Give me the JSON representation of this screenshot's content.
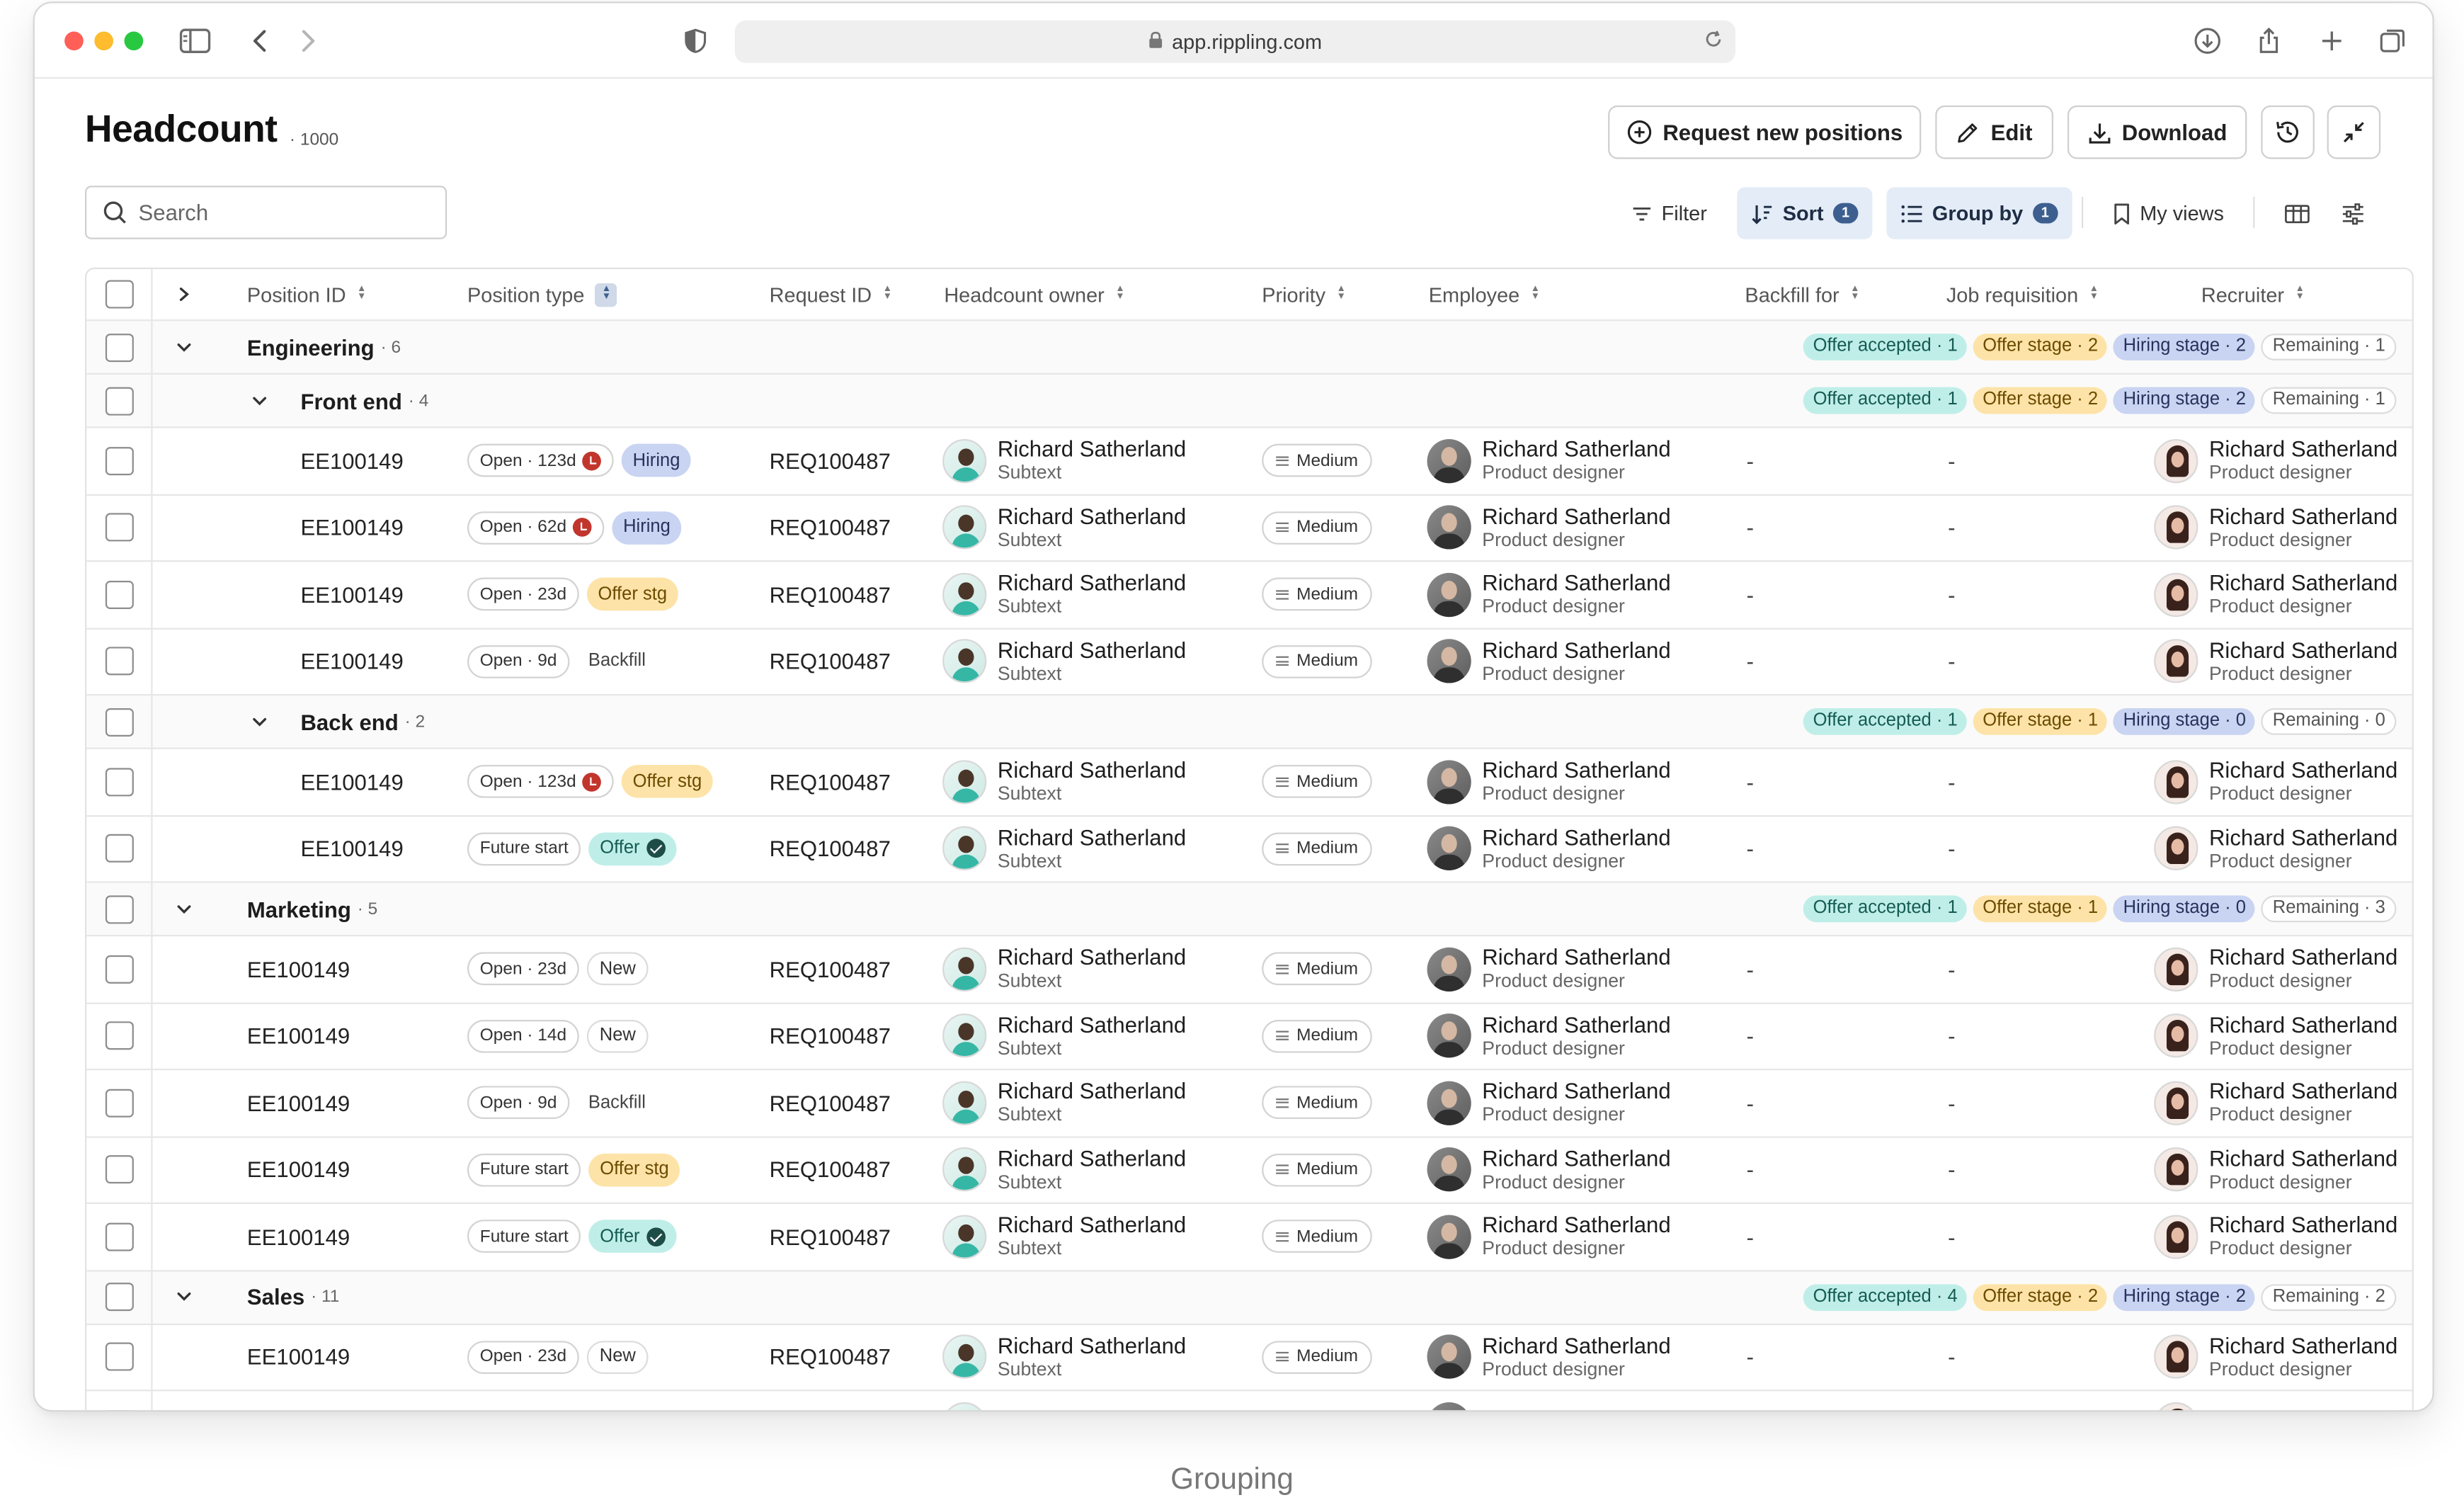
{
  "browser": {
    "url": "app.rippling.com"
  },
  "page": {
    "title": "Headcount",
    "count": "1000"
  },
  "actions": {
    "request": "Request new positions",
    "edit": "Edit",
    "download": "Download"
  },
  "toolbar": {
    "search_placeholder": "Search",
    "filter": "Filter",
    "sort": "Sort",
    "sort_count": "1",
    "group_by": "Group by",
    "group_count": "1",
    "my_views": "My views"
  },
  "columns": {
    "position_id": "Position ID",
    "position_type": "Position type",
    "request_id": "Request ID",
    "headcount_owner": "Headcount owner",
    "priority": "Priority",
    "employee": "Employee",
    "backfill_for": "Backfill for",
    "job_requisition": "Job requisition",
    "recruiter": "Recruiter"
  },
  "rows": [
    {
      "kind": "group",
      "level": 1,
      "name": "Engineering",
      "count": "· 6",
      "stats": [
        "Offer accepted · 1",
        "Offer stage · 2",
        "Hiring stage · 2",
        "Remaining · 1"
      ]
    },
    {
      "kind": "group",
      "level": 2,
      "name": "Front end",
      "count": "· 4",
      "stats": [
        "Offer accepted · 1",
        "Offer stage · 2",
        "Hiring stage · 2",
        "Remaining · 1"
      ]
    },
    {
      "kind": "data",
      "indent": 2,
      "pid": "EE100149",
      "open": "Open · 123d",
      "clock": true,
      "tag": "Hiring",
      "tag_style": "hiring",
      "req": "REQ100487",
      "owner": "Richard Satherland",
      "owner_sub": "Subtext",
      "priority": "Medium",
      "employee": "Richard Satherland",
      "employee_sub": "Product designer",
      "backfill": "-",
      "job": "-",
      "recruiter": "Richard Satherland",
      "recruiter_sub": "Product designer"
    },
    {
      "kind": "data",
      "indent": 2,
      "pid": "EE100149",
      "open": "Open · 62d",
      "clock": true,
      "tag": "Hiring",
      "tag_style": "hiring",
      "req": "REQ100487",
      "owner": "Richard Satherland",
      "owner_sub": "Subtext",
      "priority": "Medium",
      "employee": "Richard Satherland",
      "employee_sub": "Product designer",
      "backfill": "-",
      "job": "-",
      "recruiter": "Richard Satherland",
      "recruiter_sub": "Product designer"
    },
    {
      "kind": "data",
      "indent": 2,
      "pid": "EE100149",
      "open": "Open · 23d",
      "clock": false,
      "tag": "Offer stg",
      "tag_style": "offerstg",
      "req": "REQ100487",
      "owner": "Richard Satherland",
      "owner_sub": "Subtext",
      "priority": "Medium",
      "employee": "Richard Satherland",
      "employee_sub": "Product designer",
      "backfill": "-",
      "job": "-",
      "recruiter": "Richard Satherland",
      "recruiter_sub": "Product designer"
    },
    {
      "kind": "data",
      "indent": 2,
      "pid": "EE100149",
      "open": "Open · 9d",
      "clock": false,
      "tag": "Backfill",
      "tag_style": "backfill",
      "req": "REQ100487",
      "owner": "Richard Satherland",
      "owner_sub": "Subtext",
      "priority": "Medium",
      "employee": "Richard Satherland",
      "employee_sub": "Product designer",
      "backfill": "-",
      "job": "-",
      "recruiter": "Richard Satherland",
      "recruiter_sub": "Product designer"
    },
    {
      "kind": "group",
      "level": 2,
      "name": "Back end",
      "count": "· 2",
      "stats": [
        "Offer accepted · 1",
        "Offer stage · 1",
        "Hiring stage · 0",
        "Remaining · 0"
      ]
    },
    {
      "kind": "data",
      "indent": 2,
      "pid": "EE100149",
      "open": "Open · 123d",
      "clock": true,
      "tag": "Offer stg",
      "tag_style": "offerstg",
      "req": "REQ100487",
      "owner": "Richard Satherland",
      "owner_sub": "Subtext",
      "priority": "Medium",
      "employee": "Richard Satherland",
      "employee_sub": "Product designer",
      "backfill": "-",
      "job": "-",
      "recruiter": "Richard Satherland",
      "recruiter_sub": "Product designer"
    },
    {
      "kind": "data",
      "indent": 2,
      "pid": "EE100149",
      "open": "Future start",
      "clock": false,
      "tag": "Offer",
      "tag_style": "offer",
      "req": "REQ100487",
      "owner": "Richard Satherland",
      "owner_sub": "Subtext",
      "priority": "Medium",
      "employee": "Richard Satherland",
      "employee_sub": "Product designer",
      "backfill": "-",
      "job": "-",
      "recruiter": "Richard Satherland",
      "recruiter_sub": "Product designer"
    },
    {
      "kind": "group",
      "level": 1,
      "name": "Marketing",
      "count": "· 5",
      "stats": [
        "Offer accepted · 1",
        "Offer stage · 1",
        "Hiring stage · 0",
        "Remaining · 3"
      ]
    },
    {
      "kind": "data",
      "indent": 1,
      "pid": "EE100149",
      "open": "Open · 23d",
      "clock": false,
      "tag": "New",
      "tag_style": "new",
      "req": "REQ100487",
      "owner": "Richard Satherland",
      "owner_sub": "Subtext",
      "priority": "Medium",
      "employee": "Richard Satherland",
      "employee_sub": "Product designer",
      "backfill": "-",
      "job": "-",
      "recruiter": "Richard Satherland",
      "recruiter_sub": "Product designer"
    },
    {
      "kind": "data",
      "indent": 1,
      "pid": "EE100149",
      "open": "Open · 14d",
      "clock": false,
      "tag": "New",
      "tag_style": "new",
      "req": "REQ100487",
      "owner": "Richard Satherland",
      "owner_sub": "Subtext",
      "priority": "Medium",
      "employee": "Richard Satherland",
      "employee_sub": "Product designer",
      "backfill": "-",
      "job": "-",
      "recruiter": "Richard Satherland",
      "recruiter_sub": "Product designer"
    },
    {
      "kind": "data",
      "indent": 1,
      "pid": "EE100149",
      "open": "Open · 9d",
      "clock": false,
      "tag": "Backfill",
      "tag_style": "backfill",
      "req": "REQ100487",
      "owner": "Richard Satherland",
      "owner_sub": "Subtext",
      "priority": "Medium",
      "employee": "Richard Satherland",
      "employee_sub": "Product designer",
      "backfill": "-",
      "job": "-",
      "recruiter": "Richard Satherland",
      "recruiter_sub": "Product designer"
    },
    {
      "kind": "data",
      "indent": 1,
      "pid": "EE100149",
      "open": "Future start",
      "clock": false,
      "tag": "Offer stg",
      "tag_style": "offerstg",
      "req": "REQ100487",
      "owner": "Richard Satherland",
      "owner_sub": "Subtext",
      "priority": "Medium",
      "employee": "Richard Satherland",
      "employee_sub": "Product designer",
      "backfill": "-",
      "job": "-",
      "recruiter": "Richard Satherland",
      "recruiter_sub": "Product designer"
    },
    {
      "kind": "data",
      "indent": 1,
      "pid": "EE100149",
      "open": "Future start",
      "clock": false,
      "tag": "Offer",
      "tag_style": "offer",
      "req": "REQ100487",
      "owner": "Richard Satherland",
      "owner_sub": "Subtext",
      "priority": "Medium",
      "employee": "Richard Satherland",
      "employee_sub": "Product designer",
      "backfill": "-",
      "job": "-",
      "recruiter": "Richard Satherland",
      "recruiter_sub": "Product designer"
    },
    {
      "kind": "group",
      "level": 1,
      "name": "Sales",
      "count": "· 11",
      "stats": [
        "Offer accepted · 4",
        "Offer stage · 2",
        "Hiring stage · 2",
        "Remaining · 2"
      ]
    },
    {
      "kind": "data",
      "indent": 1,
      "pid": "EE100149",
      "open": "Open · 23d",
      "clock": false,
      "tag": "New",
      "tag_style": "new",
      "req": "REQ100487",
      "owner": "Richard Satherland",
      "owner_sub": "Subtext",
      "priority": "Medium",
      "employee": "Richard Satherland",
      "employee_sub": "Product designer",
      "backfill": "-",
      "job": "-",
      "recruiter": "Richard Satherland",
      "recruiter_sub": "Product designer"
    },
    {
      "kind": "data",
      "indent": 1,
      "pid": "",
      "open": "",
      "clock": false,
      "tag": "",
      "tag_style": "",
      "req": "",
      "owner": "Richard Satherland",
      "owner_sub": "",
      "priority": "",
      "employee": "Richard Satherland",
      "employee_sub": "",
      "backfill": "",
      "job": "",
      "recruiter": "Richard Satherland",
      "recruiter_sub": ""
    }
  ],
  "caption": "Grouping"
}
